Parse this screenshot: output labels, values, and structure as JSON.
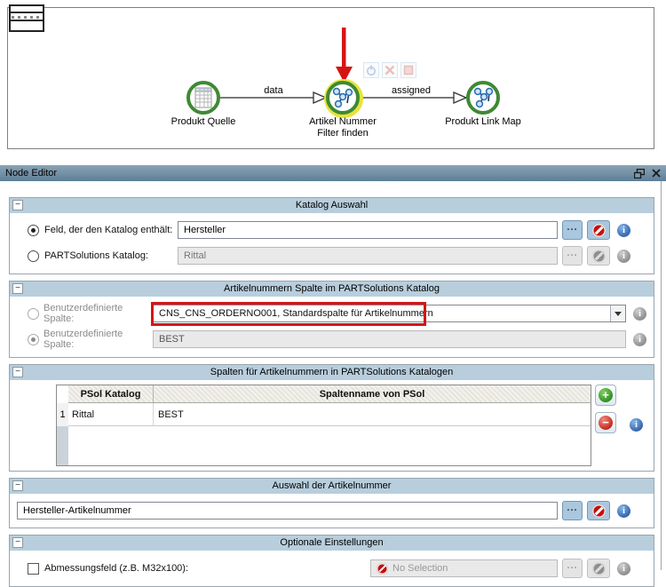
{
  "workflow": {
    "nodes": [
      {
        "label": "Produkt Quelle",
        "icon": "spreadsheet-icon"
      },
      {
        "label": "Artikel Nummer Filter finden",
        "icon": "network-icon"
      },
      {
        "label": "Produkt Link Map",
        "icon": "network-icon"
      }
    ],
    "edges": [
      {
        "label": "data"
      },
      {
        "label": "assigned"
      }
    ],
    "hover_actions": [
      "power-icon",
      "delete-x-icon",
      "stop-square-icon"
    ],
    "annotation_color": "#d61414"
  },
  "editor": {
    "title": "Node Editor",
    "browse_label": "...",
    "collapse_glyph": "−",
    "sections": {
      "katalog": {
        "title": "Katalog Auswahl",
        "rows": [
          {
            "label": "Feld, der den Katalog enthält:",
            "value": "Hersteller",
            "selected": true
          },
          {
            "label": "PARTSolutions Katalog:",
            "value": "Rittal",
            "selected": false
          }
        ]
      },
      "artikelnummern": {
        "title": "Artikelnummern Spalte im PARTSolutions Katalog",
        "rows": [
          {
            "label": "Benutzerdefinierte Spalte:",
            "value": "CNS_CNS_ORDERNO001, Standardspalte für Artikelnummern",
            "selected": false
          },
          {
            "label": "Benutzerdefinierte Spalte:",
            "value": "BEST",
            "selected": true
          }
        ]
      },
      "spalten": {
        "title": "Spalten für Artikelnummern in PARTSolutions Katalogen",
        "table": {
          "headers": [
            "PSol Katalog",
            "Spaltenname von PSol"
          ],
          "rows": [
            {
              "num": "1",
              "katalog": "Rittal",
              "spaltenname": "BEST"
            }
          ]
        }
      },
      "auswahl": {
        "title": "Auswahl der Artikelnummer",
        "value": "Hersteller-Artikelnummer"
      },
      "optional": {
        "title": "Optionale Einstellungen",
        "checkbox_label": "Abmessungsfeld (z.B. M32x100):",
        "value": "No Selection"
      }
    },
    "colors": {
      "titlebar": "#6f8ea4",
      "section_header": "#b8cedd",
      "enabled_button": "#a9c7de",
      "info": "#3467b0",
      "add": "#2f8c22",
      "remove": "#c22718",
      "node_ring": "#3e8a33",
      "selected_glow": "#e9e23c"
    }
  }
}
